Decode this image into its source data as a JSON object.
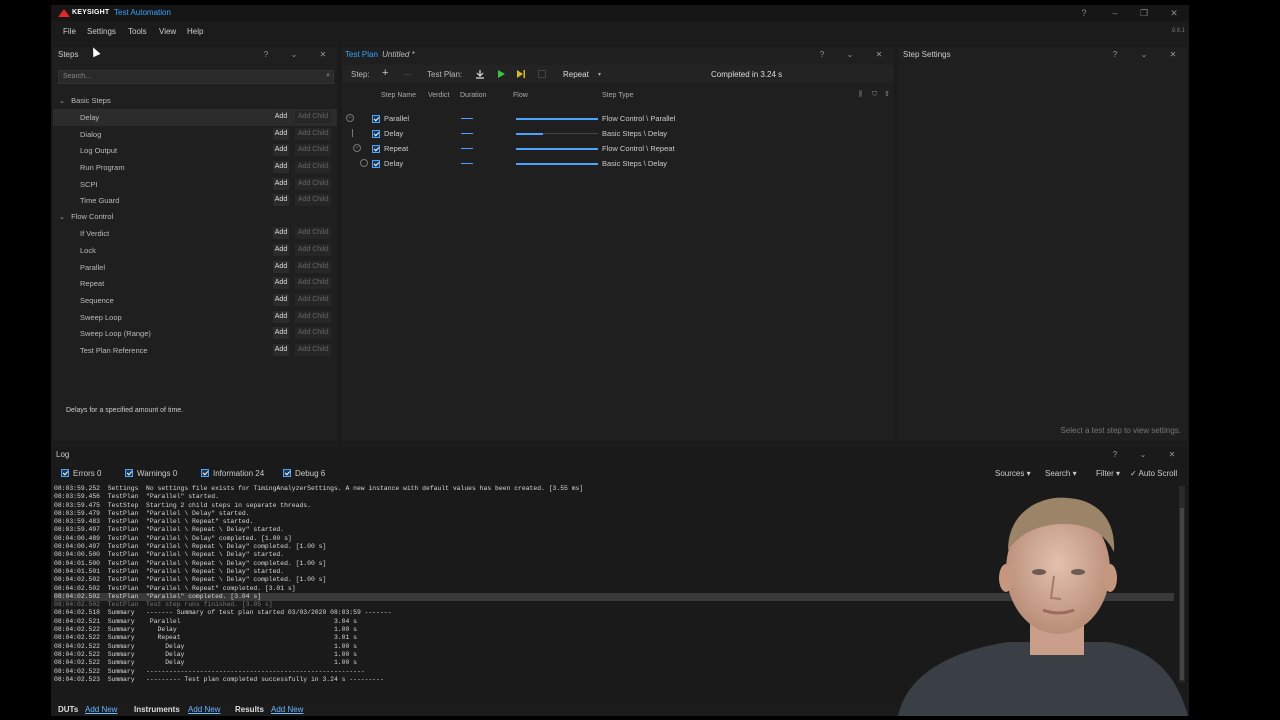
{
  "titlebar": {
    "brand": "KEYSIGHT",
    "app_title": "Test Automation",
    "help": "?",
    "minimize": "–",
    "restore": "❐",
    "close": "✕"
  },
  "menu": {
    "items": [
      "File",
      "Settings",
      "Tools",
      "View",
      "Help"
    ],
    "version": "9.6.1"
  },
  "steps_panel": {
    "title": "Steps",
    "search_placeholder": "Search...",
    "groups": [
      {
        "label": "Basic Steps",
        "steps": [
          "Delay",
          "Dialog",
          "Log Output",
          "Run Program",
          "SCPI",
          "Time Guard"
        ]
      },
      {
        "label": "Flow Control",
        "steps": [
          "If Verdict",
          "Lock",
          "Parallel",
          "Repeat",
          "Sequence",
          "Sweep Loop",
          "Sweep Loop (Range)",
          "Test Plan Reference"
        ]
      }
    ],
    "add_label": "Add",
    "add_child_label": "Add Child",
    "description": "Delays for a specified amount of time."
  },
  "test_plan": {
    "title": "Test Plan",
    "subtitle": "Untitled *",
    "toolbar": {
      "step_label": "Step:",
      "add": "+",
      "remove": "—",
      "test_plan_label": "Test Plan:",
      "repeat_label": "Repeat",
      "status": "Completed in 3.24 s"
    },
    "columns": [
      "Step Name",
      "Verdict",
      "Duration",
      "Flow",
      "Step Type"
    ],
    "rows": [
      {
        "name": "Parallel",
        "type": "Flow Control \\ Parallel",
        "flow_start": 0.0,
        "flow_end": 1.0
      },
      {
        "name": "Delay",
        "type": "Basic Steps \\ Delay",
        "flow_start": 0.0,
        "flow_end": 0.33
      },
      {
        "name": "Repeat",
        "type": "Flow Control \\ Repeat",
        "flow_start": 0.0,
        "flow_end": 1.0
      },
      {
        "name": "Delay",
        "type": "Basic Steps \\ Delay",
        "flow_start": 0.0,
        "flow_end": 1.0
      }
    ]
  },
  "step_settings": {
    "title": "Step Settings",
    "hint": "Select a test step to view settings."
  },
  "log": {
    "title": "Log",
    "filters": [
      "Errors 0",
      "Warnings 0",
      "Information 24",
      "Debug 6"
    ],
    "tools": [
      "Sources ▾",
      "Search ▾",
      "Filter ▾",
      "✓ Auto Scroll"
    ],
    "lines": [
      "08:03:59.252  Settings  No settings file exists for TimingAnalyzerSettings. A new instance with default values has been created. [3.55 ms]",
      "08:03:59.456  TestPlan  \"Parallel\" started.",
      "08:03:59.475  TestStep  Starting 2 child steps in separate threads.",
      "08:03:59.479  TestPlan  \"Parallel \\ Delay\" started.",
      "08:03:59.483  TestPlan  \"Parallel \\ Repeat\" started.",
      "08:03:59.497  TestPlan  \"Parallel \\ Repeat \\ Delay\" started.",
      "08:04:00.489  TestPlan  \"Parallel \\ Delay\" completed. [1.00 s]",
      "08:04:00.497  TestPlan  \"Parallel \\ Repeat \\ Delay\" completed. [1.00 s]",
      "08:04:00.500  TestPlan  \"Parallel \\ Repeat \\ Delay\" started.",
      "08:04:01.500  TestPlan  \"Parallel \\ Repeat \\ Delay\" completed. [1.00 s]",
      "08:04:01.501  TestPlan  \"Parallel \\ Repeat \\ Delay\" started.",
      "08:04:02.502  TestPlan  \"Parallel \\ Repeat \\ Delay\" completed. [1.00 s]",
      "08:04:02.502  TestPlan  \"Parallel \\ Repeat\" completed. [3.01 s]",
      "08:04:02.502  TestPlan  \"Parallel\" completed. [3.04 s]",
      "08:04:02.502  TestPlan  Test step runs finished. [3.05 s]",
      "08:04:02.518  Summary   ------- Summary of test plan started 03/03/2020 08:03:59 -------",
      "08:04:02.521  Summary    Parallel                                        3.04 s",
      "08:04:02.522  Summary      Delay                                         1.00 s",
      "08:04:02.522  Summary      Repeat                                        3.01 s",
      "08:04:02.522  Summary        Delay                                       1.00 s",
      "08:04:02.522  Summary        Delay                                       1.00 s",
      "08:04:02.522  Summary        Delay                                       1.00 s",
      "08:04:02.522  Summary   ---------------------------------------------------------",
      "08:04:02.523  Summary   --------- Test plan completed successfully in 3.24 s ---------"
    ],
    "highlight_index": 13,
    "dim_index": 14
  },
  "bottom_bar": {
    "items": [
      {
        "label": "DUTs",
        "link": "Add New"
      },
      {
        "label": "Instruments",
        "link": "Add New"
      },
      {
        "label": "Results",
        "link": "Add New"
      }
    ]
  },
  "colors": {
    "accent": "#36a2ff",
    "brand_red": "#e0262f",
    "panel": "#1f1f1f",
    "background": "#1b1b1b"
  }
}
